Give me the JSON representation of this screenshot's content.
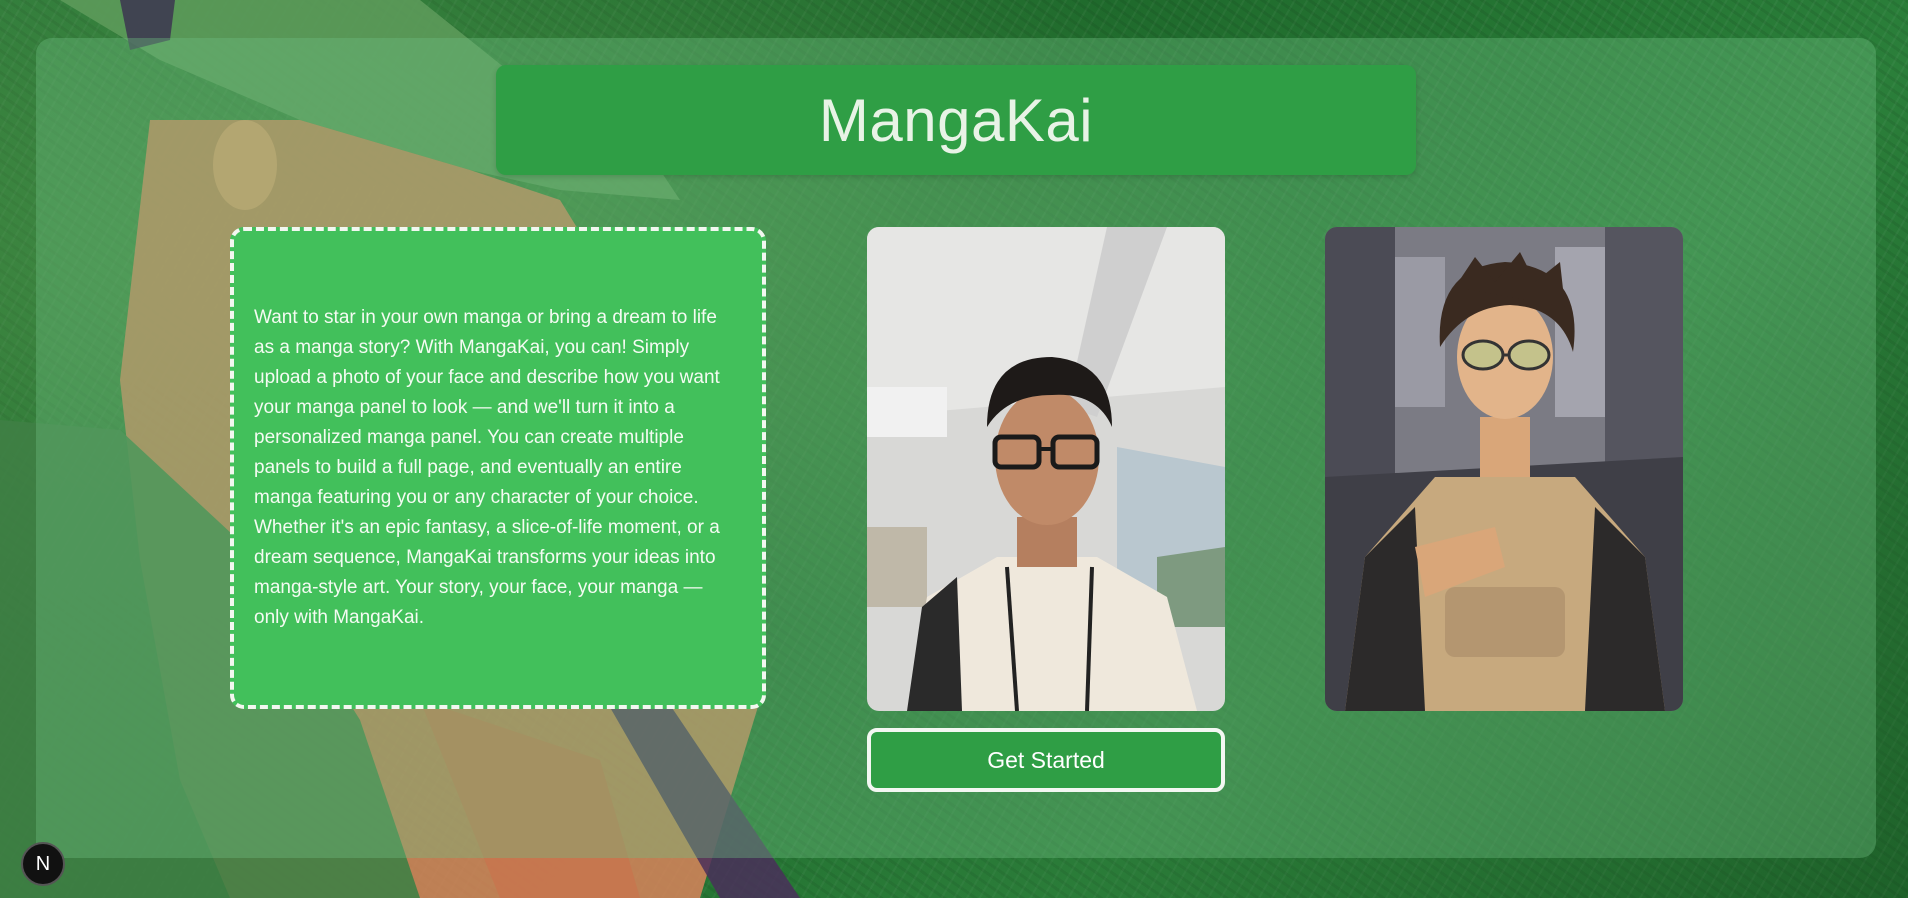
{
  "header": {
    "title": "MangaKai"
  },
  "intro": {
    "text": "Want to star in your own manga or bring a dream to life as a manga story? With MangaKai, you can! Simply upload a photo of your face and describe how you want your manga panel to look — and we'll turn it into a personalized manga panel. You can create multiple panels to build a full page, and eventually an entire manga featuring you or any character of your choice. Whether it's an epic fantasy, a slice-of-life moment, or a dream sequence, MangaKai transforms your ideas into manga-style art. Your story, your face, your manga — only with MangaKai."
  },
  "cta": {
    "label": "Get Started"
  },
  "dev_badge": {
    "label": "N"
  },
  "colors": {
    "accent": "#2f9e45",
    "description_bg": "#42c05b",
    "title_text": "#e8f3e6"
  }
}
